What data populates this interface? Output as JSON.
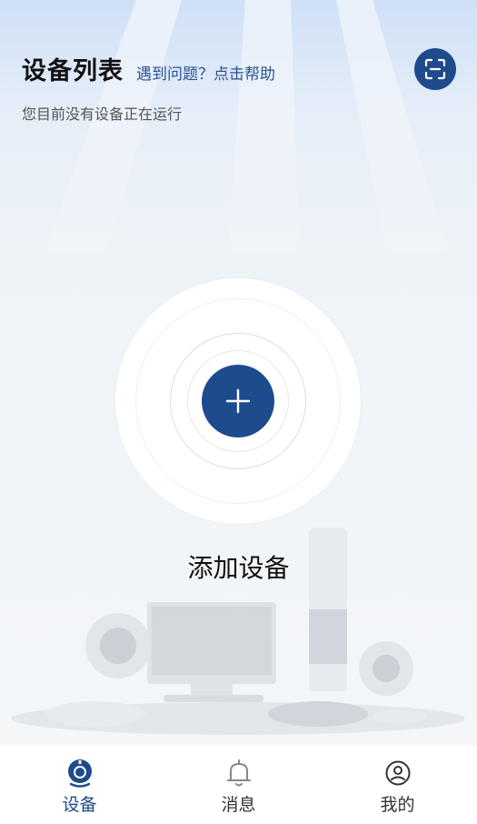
{
  "header": {
    "title": "设备列表",
    "help_link": "遇到问题？点击帮助",
    "subtitle": "您目前没有设备正在运行"
  },
  "scan_button": {
    "icon": "scan-icon"
  },
  "add_device": {
    "icon": "plus-icon",
    "label": "添加设备"
  },
  "tabs": [
    {
      "label": "设备",
      "icon": "camera-icon",
      "active": true
    },
    {
      "label": "消息",
      "icon": "bell-icon",
      "active": false
    },
    {
      "label": "我的",
      "icon": "user-icon",
      "active": false
    }
  ],
  "colors": {
    "accent": "#1e4b8c",
    "link": "#2a5192"
  }
}
